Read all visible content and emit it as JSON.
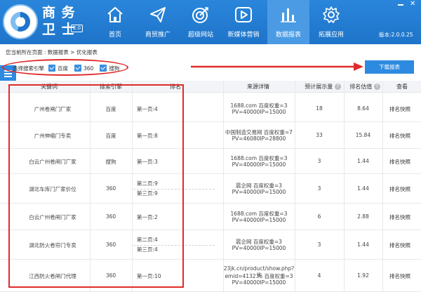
{
  "header": {
    "brand_line1": "商 务",
    "brand_line2": "卫 士",
    "brand_badge": "2.0",
    "nav": [
      {
        "label": "首页",
        "icon": "home-icon"
      },
      {
        "label": "商贸推广",
        "icon": "paper-plane-icon"
      },
      {
        "label": "超级网站",
        "icon": "target-icon"
      },
      {
        "label": "新媒体营销",
        "icon": "play-icon"
      },
      {
        "label": "数据报表",
        "icon": "bar-chart-icon"
      },
      {
        "label": "拓展应用",
        "icon": "gear-icon"
      }
    ],
    "active_nav": "数据报表",
    "version": "版本:2.0.0.25"
  },
  "breadcrumb": "您当前所在页面 : 数据报表 > 优化报表",
  "filter": {
    "label": "选择搜索引擎",
    "options": [
      {
        "label": "百度",
        "checked": true
      },
      {
        "label": "360",
        "checked": true
      },
      {
        "label": "搜狗",
        "checked": true
      }
    ],
    "download_label": "下载报表"
  },
  "table": {
    "headers": [
      "关键词",
      "搜索引擎",
      "排名",
      "来源详情",
      "预计展示量",
      "排名估值",
      "查看"
    ],
    "rows": [
      {
        "keyword": "广州卷闸门厂家",
        "engine": "百度",
        "ranks": [
          "第一页:4"
        ],
        "source": [
          "1688.com 百度权重=3",
          "PV=40000IP=15000"
        ],
        "views": "18",
        "value": "8.64",
        "action": "排名快照"
      },
      {
        "keyword": "广州伸缩门专卖",
        "engine": "百度",
        "ranks": [
          "第一页:8"
        ],
        "source": [
          "中国制造交易网 百度权重=7",
          "PV=46080IP=28800"
        ],
        "views": "33",
        "value": "15.84",
        "action": "排名快照"
      },
      {
        "keyword": "白云广州卷闸门厂家",
        "engine": "搜狗",
        "ranks": [
          "第一页:3"
        ],
        "source": [
          "1688.com 百度权重=3",
          "PV=40000IP=15000"
        ],
        "views": "3",
        "value": "1.44",
        "action": "排名快照"
      },
      {
        "keyword": "湖北车库门厂家价位",
        "engine": "360",
        "ranks": [
          "第二页:9",
          "第三页:9"
        ],
        "source": [
          "晨企网 百度权重=3",
          "PV=40000IP=15000"
        ],
        "views": "3",
        "value": "1.44",
        "action": "排名快照"
      },
      {
        "keyword": "白云广州卷闸门厂家",
        "engine": "360",
        "ranks": [
          "第一页:2"
        ],
        "source": [
          "1688.com 百度权重=3",
          "PV=40000IP=15000"
        ],
        "views": "6",
        "value": "2.88",
        "action": "排名快照"
      },
      {
        "keyword": "湖北防火卷帘门专卖",
        "engine": "360",
        "ranks": [
          "第二页:4",
          "第三页:4"
        ],
        "source": [
          "晨企网 百度权重=3",
          "PV=40000IP=15000"
        ],
        "views": "3",
        "value": "1.44",
        "action": "排名快照"
      },
      {
        "keyword": "江西防火卷闸门代理",
        "engine": "360",
        "ranks": [
          "第一页:10"
        ],
        "source": [
          "23jk.cn/product/show.php?it",
          "emid=413236 百度权重=3",
          "PV=40000IP=15000"
        ],
        "views": "4",
        "value": "1.92",
        "action": "排名快照"
      }
    ]
  },
  "colors": {
    "header_blue": "#1e74c9",
    "accent_blue": "#2d8ae0",
    "annotation_red": "#e02a2a"
  }
}
